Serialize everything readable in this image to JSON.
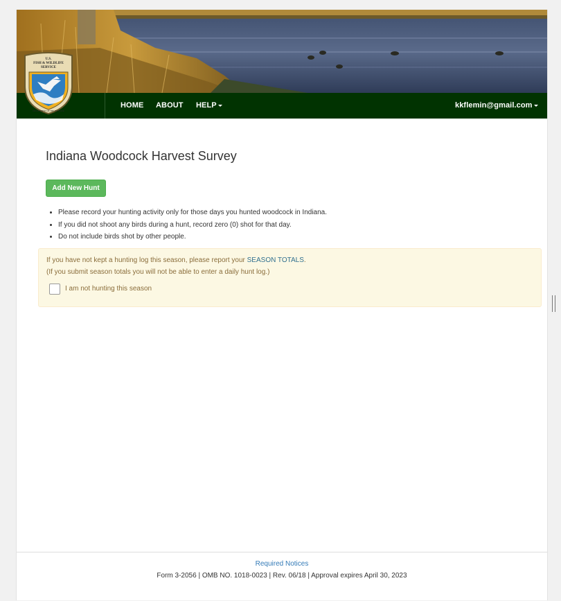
{
  "agency": {
    "seal_lines": [
      "U.S.",
      "FISH & WILDLIFE",
      "SERVICE"
    ],
    "seal_ring_text": "DEPARTMENT OF THE INTERIOR"
  },
  "nav": {
    "items": [
      {
        "label": "HOME"
      },
      {
        "label": "ABOUT"
      },
      {
        "label": "HELP"
      }
    ],
    "user_email": "kkflemin@gmail.com"
  },
  "main": {
    "title": "Indiana Woodcock Harvest Survey",
    "add_hunt_label": "Add New Hunt",
    "instructions": [
      "Please record your hunting activity only for those days you hunted woodcock in Indiana.",
      "If you did not shoot any birds during a hunt, record zero (0) shot for that day.",
      "Do not include birds shot by other people."
    ]
  },
  "season_box": {
    "line1_prefix": "If you have not kept a hunting log this season, please report your ",
    "line1_link": "SEASON TOTALS",
    "line1_suffix": ".",
    "line2": "(If you submit season totals you will not be able to enter a daily hunt log.)",
    "checkbox_label": "I am not hunting this season",
    "checkbox_checked": false
  },
  "footer": {
    "required_notices": "Required Notices",
    "form_info": "Form 3-2056 | OMB NO. 1018-0023 | Rev. 06/18 | Approval expires April 30, 2023"
  },
  "colors": {
    "navbar": "#013301",
    "add_button": "#5cb85c",
    "alert_bg": "#fcf8e3",
    "alert_text": "#8a6d3b",
    "link": "#337ab7"
  }
}
